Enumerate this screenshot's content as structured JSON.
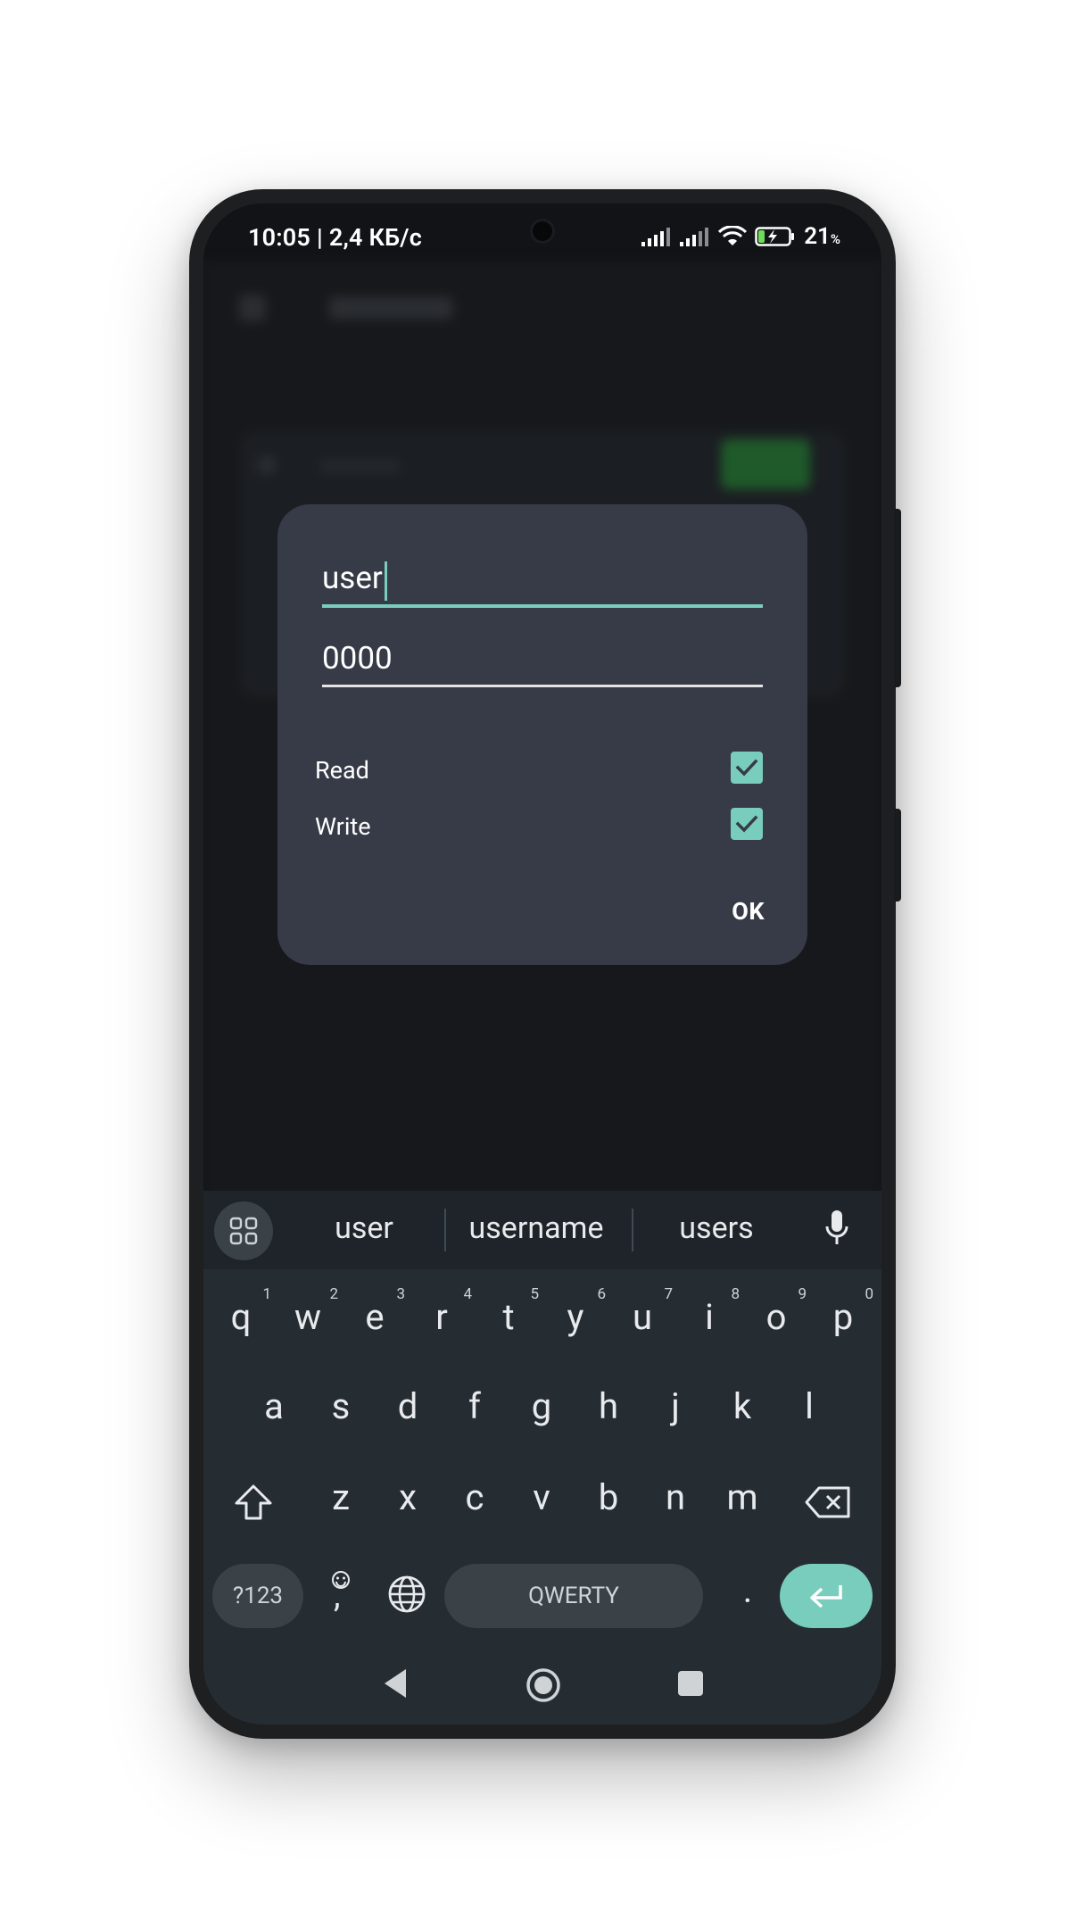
{
  "status_bar": {
    "time_speed": "10:05 | 2,4 КБ/с",
    "battery_percent": "21",
    "battery_suffix": "%"
  },
  "dialog": {
    "username_value": "user",
    "password_value": "0000",
    "permissions": [
      {
        "label": "Read",
        "checked": true
      },
      {
        "label": "Write",
        "checked": true
      }
    ],
    "ok_label": "OK"
  },
  "keyboard": {
    "suggestions": [
      "user",
      "username",
      "users"
    ],
    "row1": [
      {
        "key": "q",
        "hint": "1"
      },
      {
        "key": "w",
        "hint": "2"
      },
      {
        "key": "e",
        "hint": "3"
      },
      {
        "key": "r",
        "hint": "4"
      },
      {
        "key": "t",
        "hint": "5"
      },
      {
        "key": "y",
        "hint": "6"
      },
      {
        "key": "u",
        "hint": "7"
      },
      {
        "key": "i",
        "hint": "8"
      },
      {
        "key": "o",
        "hint": "9"
      },
      {
        "key": "p",
        "hint": "0"
      }
    ],
    "row2": [
      "a",
      "s",
      "d",
      "f",
      "g",
      "h",
      "j",
      "k",
      "l"
    ],
    "row3": [
      "z",
      "x",
      "c",
      "v",
      "b",
      "n",
      "m"
    ],
    "symbols_label": "?123",
    "comma_label": ",",
    "space_label": "QWERTY",
    "period_label": "."
  },
  "colors": {
    "accent": "#79cdbd",
    "dialog_bg": "#363b47",
    "keyboard_bg": "#252d33"
  },
  "icons": {
    "status": [
      "signal-icon",
      "signal-icon-2",
      "wifi-icon",
      "battery-charging-icon"
    ],
    "keyboard": [
      "apps-grid-icon",
      "mic-icon",
      "shift-icon",
      "backspace-icon",
      "emoji-icon",
      "globe-icon",
      "enter-icon"
    ],
    "nav": [
      "back-icon",
      "home-icon",
      "recents-icon"
    ]
  }
}
